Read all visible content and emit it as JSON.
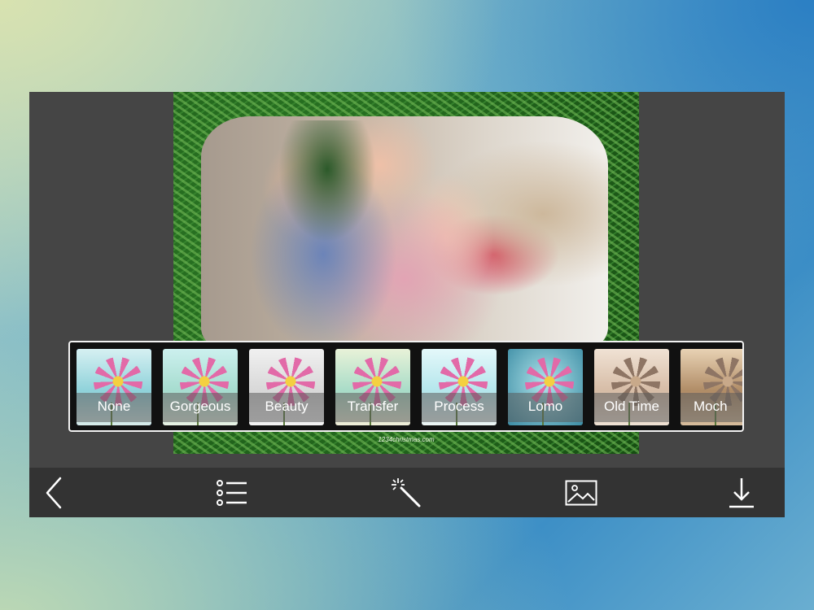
{
  "photo": {
    "watermark": "1234christmas.com"
  },
  "filters": {
    "selected": "None",
    "items": [
      {
        "label": "None"
      },
      {
        "label": "Gorgeous"
      },
      {
        "label": "Beauty"
      },
      {
        "label": "Transfer"
      },
      {
        "label": "Process"
      },
      {
        "label": "Lomo"
      },
      {
        "label": "Old Time"
      },
      {
        "label": "Moch"
      }
    ]
  },
  "toolbar": {
    "icons": [
      "back-chevron-icon",
      "list-icon",
      "magic-wand-icon",
      "image-icon",
      "download-icon"
    ]
  },
  "colors": {
    "selected_border": "#1f5fe0",
    "toolbar_bg": "#333333",
    "canvas_bg": "#454545"
  }
}
